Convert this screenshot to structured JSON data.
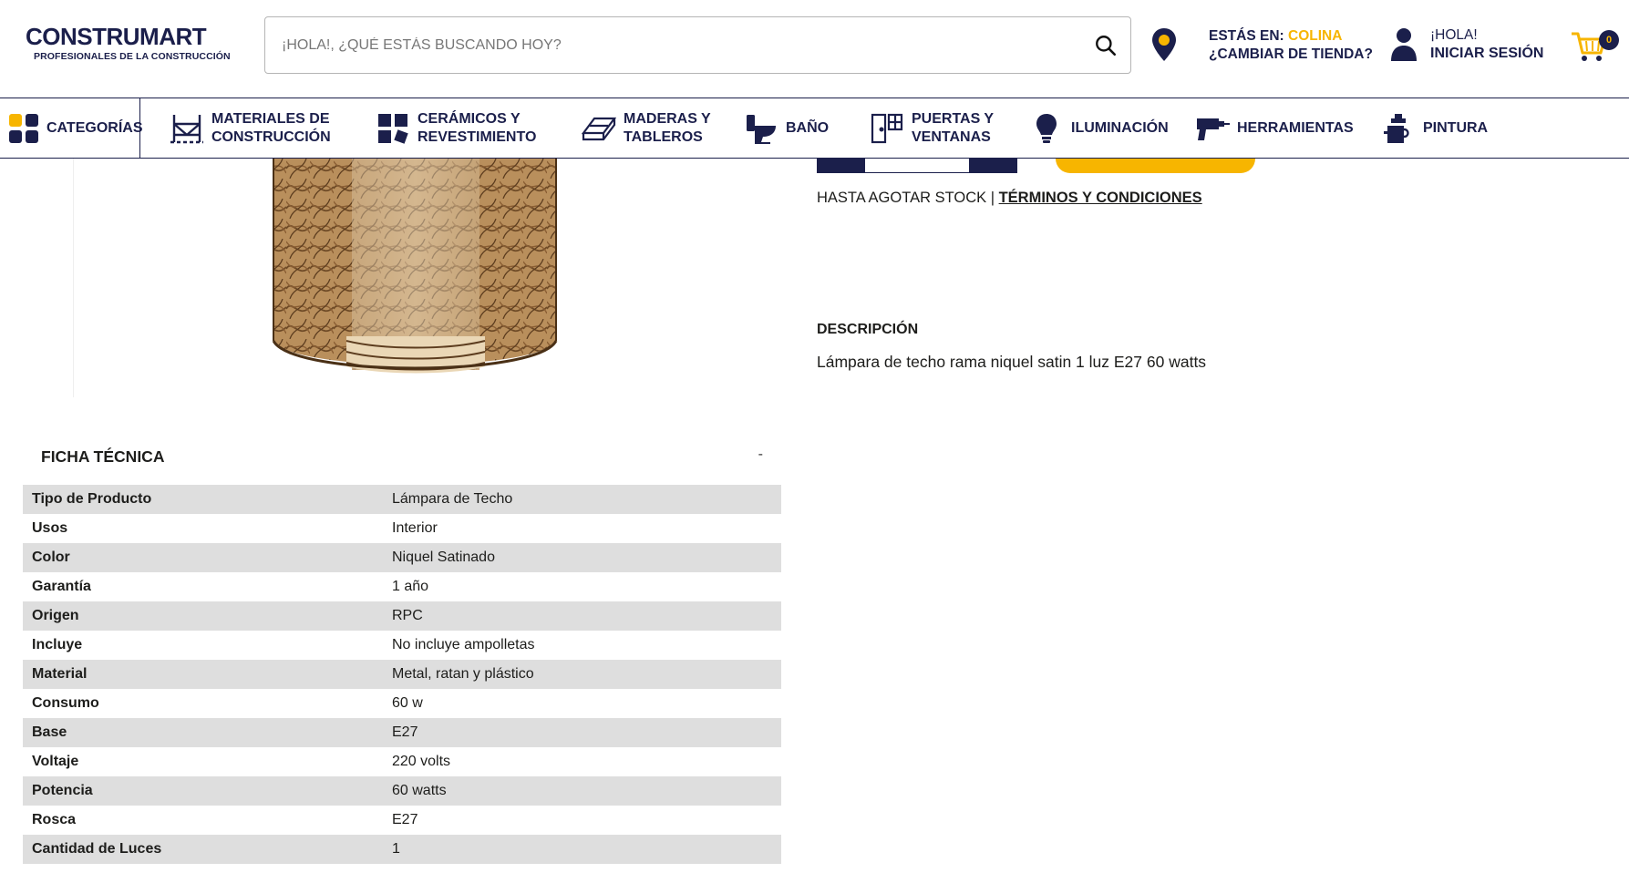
{
  "header": {
    "logo_main": "CONSTRUMART",
    "logo_sub": "PROFESIONALES DE LA CONSTRUCCIÓN",
    "search_placeholder": "¡HOLA!, ¿QUÉ ESTÁS BUSCANDO HOY?",
    "store_prefix": "ESTÁS EN:",
    "store_name": "COLINA",
    "store_change": "¿CAMBIAR DE TIENDA?",
    "greeting": "¡HOLA!",
    "login": "INICIAR SESIÓN",
    "cart_count": "0",
    "colors": {
      "brand": "#1b1f4b",
      "accent": "#f7b500"
    }
  },
  "nav": {
    "categories": "CATEGORÍAS",
    "items": [
      {
        "line1": "MATERIALES DE",
        "line2": "CONSTRUCCIÓN",
        "icon": "scaffold-icon"
      },
      {
        "line1": "CERÁMICOS Y",
        "line2": "REVESTIMIENTO",
        "icon": "tiles-icon"
      },
      {
        "line1": "MADERAS Y",
        "line2": "TABLEROS",
        "icon": "wood-planks-icon"
      },
      {
        "line1": "BAÑO",
        "line2": "",
        "icon": "toilet-icon"
      },
      {
        "line1": "PUERTAS Y",
        "line2": "VENTANAS",
        "icon": "door-window-icon"
      },
      {
        "line1": "ILUMINACIÓN",
        "line2": "",
        "icon": "lightbulb-icon"
      },
      {
        "line1": "HERRAMIENTAS",
        "line2": "",
        "icon": "drill-icon"
      },
      {
        "line1": "PINTURA",
        "line2": "",
        "icon": "paint-icon"
      }
    ]
  },
  "product": {
    "stock_text": "HASTA AGOTAR STOCK | ",
    "terms": "TÉRMINOS Y CONDICIONES",
    "description_title": "DESCRIPCIÓN",
    "description_text": "Lámpara de techo rama niquel satin 1 luz E27 60 watts"
  },
  "ficha": {
    "title": "FICHA TÉCNICA",
    "toggle": "-",
    "rows": [
      {
        "label": "Tipo de Producto",
        "value": "Lámpara de Techo"
      },
      {
        "label": "Usos",
        "value": "Interior"
      },
      {
        "label": "Color",
        "value": "Niquel Satinado"
      },
      {
        "label": "Garantía",
        "value": "1 año"
      },
      {
        "label": "Origen",
        "value": "RPC"
      },
      {
        "label": "Incluye",
        "value": "No incluye ampolletas"
      },
      {
        "label": "Material",
        "value": "Metal, ratan y plástico"
      },
      {
        "label": "Consumo",
        "value": "60 w"
      },
      {
        "label": "Base",
        "value": "E27"
      },
      {
        "label": "Voltaje",
        "value": "220 volts"
      },
      {
        "label": "Potencia",
        "value": "60 watts"
      },
      {
        "label": "Rosca",
        "value": "E27"
      },
      {
        "label": "Cantidad de Luces",
        "value": "1"
      }
    ]
  }
}
